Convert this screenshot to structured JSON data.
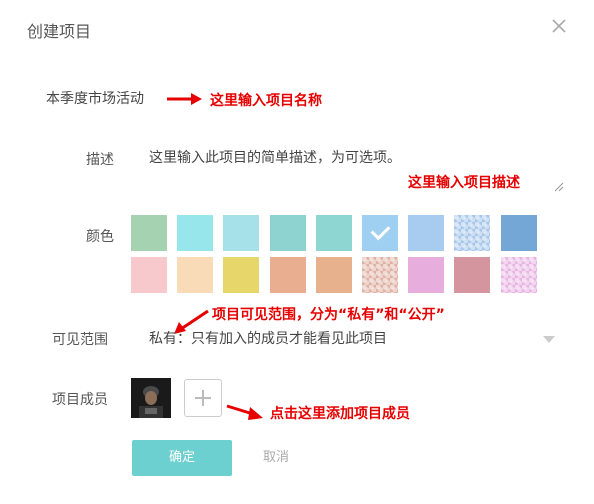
{
  "dialog": {
    "title": "创建项目",
    "close_icon": "close-icon"
  },
  "name": {
    "value": "本季度市场活动",
    "annotation": "这里输入项目名称"
  },
  "description": {
    "label": "描述",
    "placeholder": "这里输入此项目的简单描述，为可选项。",
    "annotation": "这里输入项目描述"
  },
  "colors": {
    "label": "颜色",
    "selected_index": 5,
    "swatches": [
      "#a5d2b0",
      "#96e6ec",
      "#a6e0e8",
      "#8fd3d0",
      "#8dd6d2",
      "#9fd0f2",
      "#a7ccf0",
      "#a6c6ea",
      "#74a7d6",
      "#f8c9cc",
      "#f9dbb8",
      "#e7d76b",
      "#e9ad8f",
      "#e8b18e",
      "#e0b2a6",
      "#e7addc",
      "#d5959f",
      "#e8b5e3"
    ]
  },
  "visibility": {
    "label": "可见范围",
    "value": "私有：只有加入的成员才能看见此项目",
    "annotation": "项目可见范围，分为“私有”和“公开”"
  },
  "members": {
    "label": "项目成员",
    "annotation": "点击这里添加项目成员"
  },
  "actions": {
    "ok": "确定",
    "cancel": "取消"
  }
}
